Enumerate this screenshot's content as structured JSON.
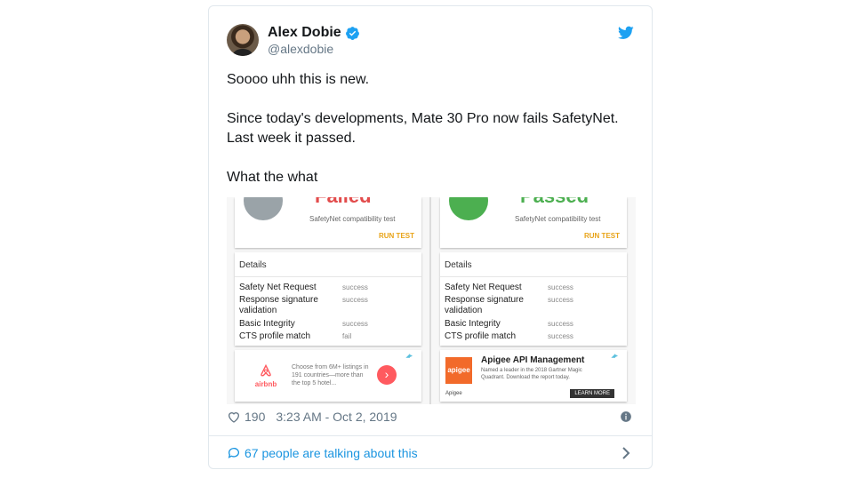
{
  "user": {
    "display_name": "Alex Dobie",
    "handle": "@alexdobie"
  },
  "tweet": {
    "lines": [
      "Soooo uhh this is new.",
      "",
      "Since today's developments, Mate 30 Pro now fails SafetyNet.",
      "Last week it passed.",
      "",
      "What the what"
    ]
  },
  "media": {
    "left": {
      "status": "Failed",
      "subtitle": "SafetyNet compatibility test",
      "run_test": "RUN TEST",
      "details_title": "Details",
      "rows": [
        {
          "label": "Safety Net Request",
          "value": "success"
        },
        {
          "label": "Response signature validation",
          "value": "success"
        },
        {
          "label": "Basic Integrity",
          "value": "success"
        },
        {
          "label": "CTS profile match",
          "value": "fail"
        }
      ],
      "ad": {
        "brand": "airbnb",
        "copy": "Choose from 6M+ listings in 191 countries—more than the top 5 hotel..."
      }
    },
    "right": {
      "status": "Passed",
      "subtitle": "SafetyNet compatibility test",
      "run_test": "RUN TEST",
      "details_title": "Details",
      "rows": [
        {
          "label": "Safety Net Request",
          "value": "success"
        },
        {
          "label": "Response signature validation",
          "value": "success"
        },
        {
          "label": "Basic Integrity",
          "value": "success"
        },
        {
          "label": "CTS profile match",
          "value": "success"
        }
      ],
      "ad": {
        "logo_text": "apigee",
        "title": "Apigee API Management",
        "copy": "Named a leader in the 2018 Gartner Magic Quadrant. Download the report today.",
        "brand_name": "Apigee",
        "cta": "LEARN MORE"
      }
    }
  },
  "meta": {
    "likes": "190",
    "timestamp": "3:23 AM - Oct 2, 2019"
  },
  "footer": {
    "conversation": "67 people are talking about this"
  },
  "colors": {
    "twitter_blue": "#1da1f2",
    "link_blue": "#1b95e0",
    "muted": "#657786",
    "fail_red": "#e24b4b",
    "pass_green": "#4caf50"
  }
}
